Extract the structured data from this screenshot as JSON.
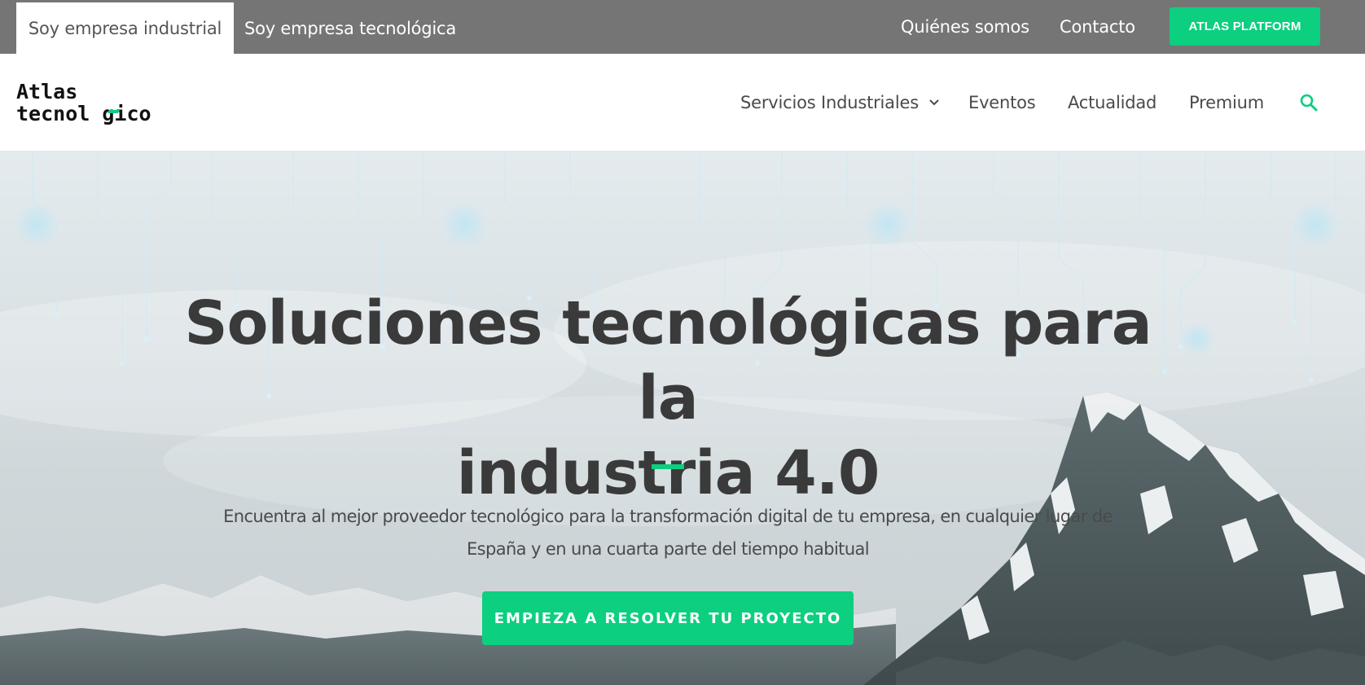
{
  "topbar": {
    "tabs": [
      {
        "label": "Soy empresa industrial",
        "active": true
      },
      {
        "label": "Soy empresa tecnológica",
        "active": false
      }
    ],
    "links": [
      "Quiénes somos",
      "Contacto"
    ],
    "platform_button": "ATLAS PLATFORM"
  },
  "logo": {
    "line1": "Atlas",
    "line2": "tecnol gico"
  },
  "nav": {
    "items": [
      {
        "label": "Servicios Industriales",
        "icon": "chevron-down-icon"
      },
      {
        "label": "Eventos"
      },
      {
        "label": "Actualidad"
      },
      {
        "label": "Premium"
      }
    ],
    "search_icon": "search-icon"
  },
  "hero": {
    "title_line1": "Soluciones tecnológicas para la",
    "title_line2": "industria 4.0",
    "subtitle_line1": "Encuentra al mejor proveedor tecnológico para la transformación digital de tu empresa, en cualquier lugar de",
    "subtitle_line2": "España y en una cuarta parte del tiempo habitual",
    "cta": "EMPIEZA A RESOLVER TU PROYECTO"
  },
  "colors": {
    "accent": "#0ccf7f",
    "topbar": "#757575",
    "text_dark": "#3a3a3a"
  }
}
